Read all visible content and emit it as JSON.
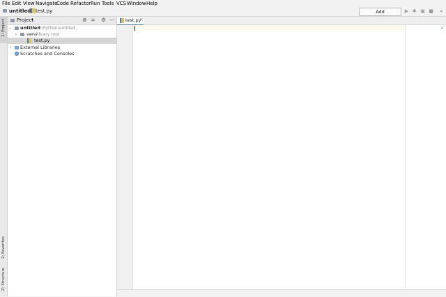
{
  "menu": [
    "File",
    "Edit",
    "View",
    "Navigate",
    "Code",
    "Refactor",
    "Run",
    "Tools",
    "VCS",
    "Window",
    "Help"
  ],
  "breadcrumb": {
    "project": "untitled",
    "file": "test.py"
  },
  "toolbar": {
    "add_configuration": "Add Configuration..."
  },
  "project_panel": {
    "title": "Project",
    "tree": [
      {
        "label": "untitled",
        "hint": "E:\\Python\\untitled",
        "level": 0,
        "expanded": true,
        "bold": true
      },
      {
        "label": "venv",
        "hint": "library root",
        "level": 1,
        "expanded": false
      },
      {
        "label": "test.py",
        "hint": "",
        "level": 1,
        "selected": true
      },
      {
        "label": "External Libraries",
        "hint": "",
        "level": 0,
        "expanded": false
      },
      {
        "label": "Scratches and Consoles",
        "hint": "",
        "level": 0
      }
    ]
  },
  "side_tabs": {
    "project": "1: Project",
    "favorites": "2: Favorites",
    "structure": "Z: Structure"
  },
  "editor": {
    "tab_label": "test.py",
    "tab_close": "×"
  },
  "colors": {
    "accent": "#4a86c7",
    "selection": "#d5d5d5",
    "caretline": "#fcfaed"
  }
}
